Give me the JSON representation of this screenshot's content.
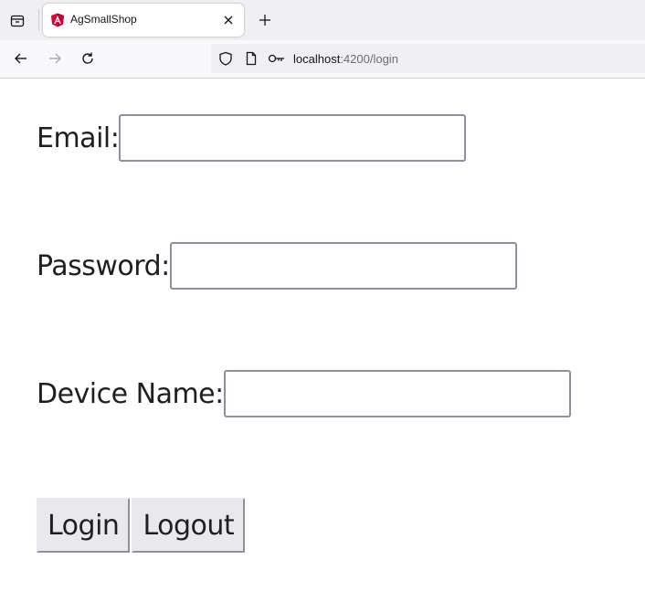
{
  "browser": {
    "tab_title": "AgSmallShop",
    "url_host": "localhost",
    "url_path": ":4200/login"
  },
  "form": {
    "email_label": "Email:",
    "email_value": "",
    "password_label": "Password:",
    "password_value": "",
    "device_label": "Device Name:",
    "device_value": ""
  },
  "actions": {
    "login_label": "Login",
    "logout_label": "Logout"
  },
  "icons": {
    "tab_list": "tab-list-icon",
    "favicon": "angular-logo-icon",
    "close": "close-icon",
    "new_tab": "plus-icon",
    "back": "arrow-left-icon",
    "forward": "arrow-right-icon",
    "reload": "reload-icon",
    "shield": "shield-icon",
    "page": "page-icon",
    "key": "key-icon"
  },
  "colors": {
    "angular_brand": "#dd0031"
  }
}
